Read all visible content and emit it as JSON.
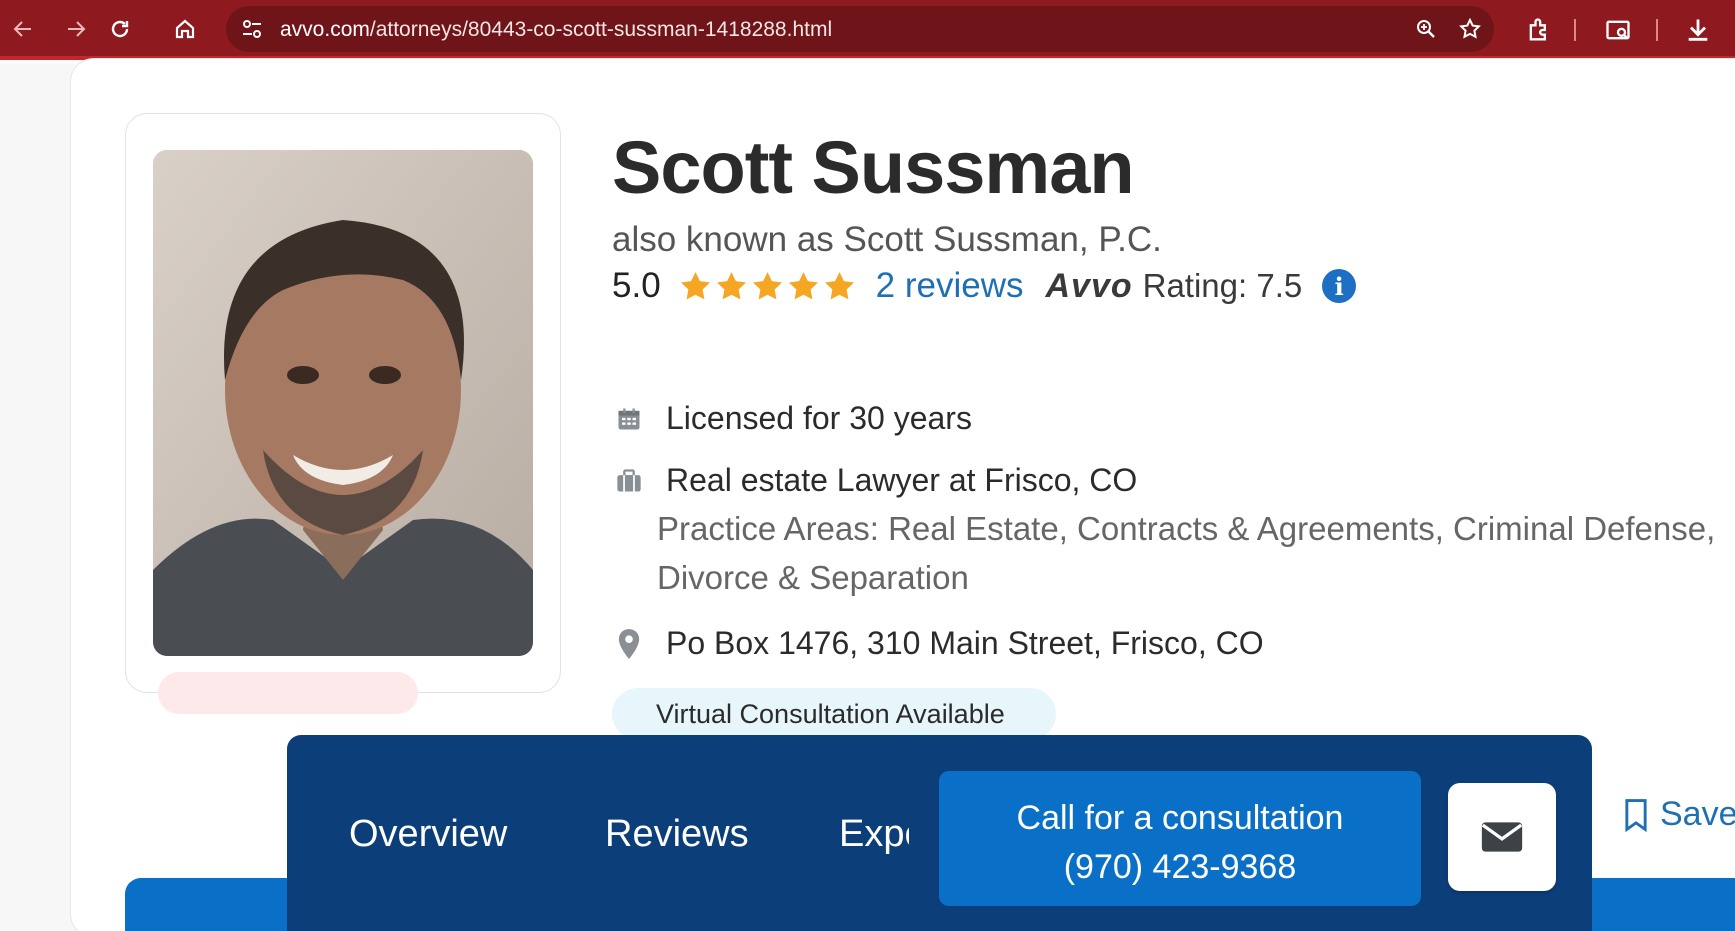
{
  "browser": {
    "url_host": "avvo.com",
    "url_path": "/attorneys/80443-co-scott-sussman-1418288.html"
  },
  "profile": {
    "name": "Scott Sussman",
    "aka": "also known as Scott Sussman, P.C.",
    "rating_score": "5.0",
    "stars": 5,
    "reviews_link": "2 reviews",
    "avvo_logo": "Avvo",
    "avvo_rating": "Rating: 7.5",
    "licensed": "Licensed for 30 years",
    "role": "Real estate Lawyer at Frisco, CO",
    "practice_areas": "Practice Areas: Real Estate, Contracts & Agreements, Criminal Defense, Divorce & Separation",
    "address": "Po Box 1476, 310 Main Street, Frisco, CO",
    "virtual_badge": "Virtual Consultation Available"
  },
  "sticky_bar": {
    "tabs": [
      "Overview",
      "Reviews",
      "Experience"
    ],
    "call_line1": "Call for a consultation",
    "call_line2": "(970) 423-9368",
    "save_label": "Save"
  },
  "colors": {
    "chrome": "#8e1a1f",
    "accent_blue": "#0a6fc7",
    "navy": "#0c3f7a",
    "star": "#f5a623"
  }
}
